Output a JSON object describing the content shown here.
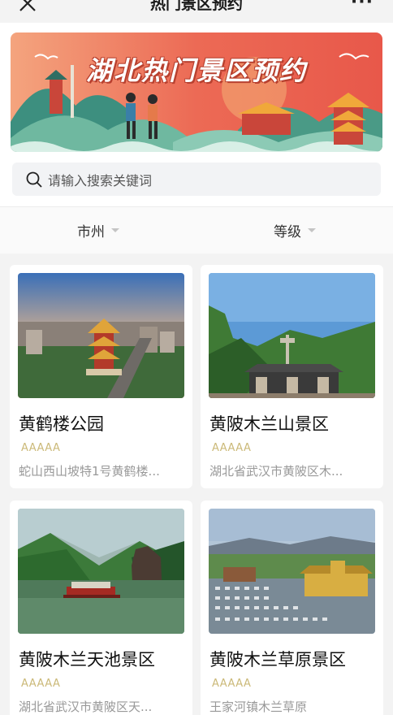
{
  "nav": {
    "title": "热门景区预约",
    "more": "···"
  },
  "banner": {
    "title": "湖北热门景区预约"
  },
  "search": {
    "placeholder": "请输入搜索关键词"
  },
  "filters": [
    {
      "label": "市州"
    },
    {
      "label": "等级"
    }
  ],
  "spots": [
    {
      "name": "黄鹤楼公园",
      "level": "AAAAA",
      "address": "蛇山西山坡特1号黄鹤楼..."
    },
    {
      "name": "黄陂木兰山景区",
      "level": "AAAAA",
      "address": "湖北省武汉市黄陂区木..."
    },
    {
      "name": "黄陂木兰天池景区",
      "level": "AAAAA",
      "address": "湖北省武汉市黄陂区天..."
    },
    {
      "name": "黄陂木兰草原景区",
      "level": "AAAAA",
      "address": "王家河镇木兰草原"
    }
  ],
  "colors": {
    "level_gold": "#cbb978",
    "banner_red": "#e8584a"
  }
}
